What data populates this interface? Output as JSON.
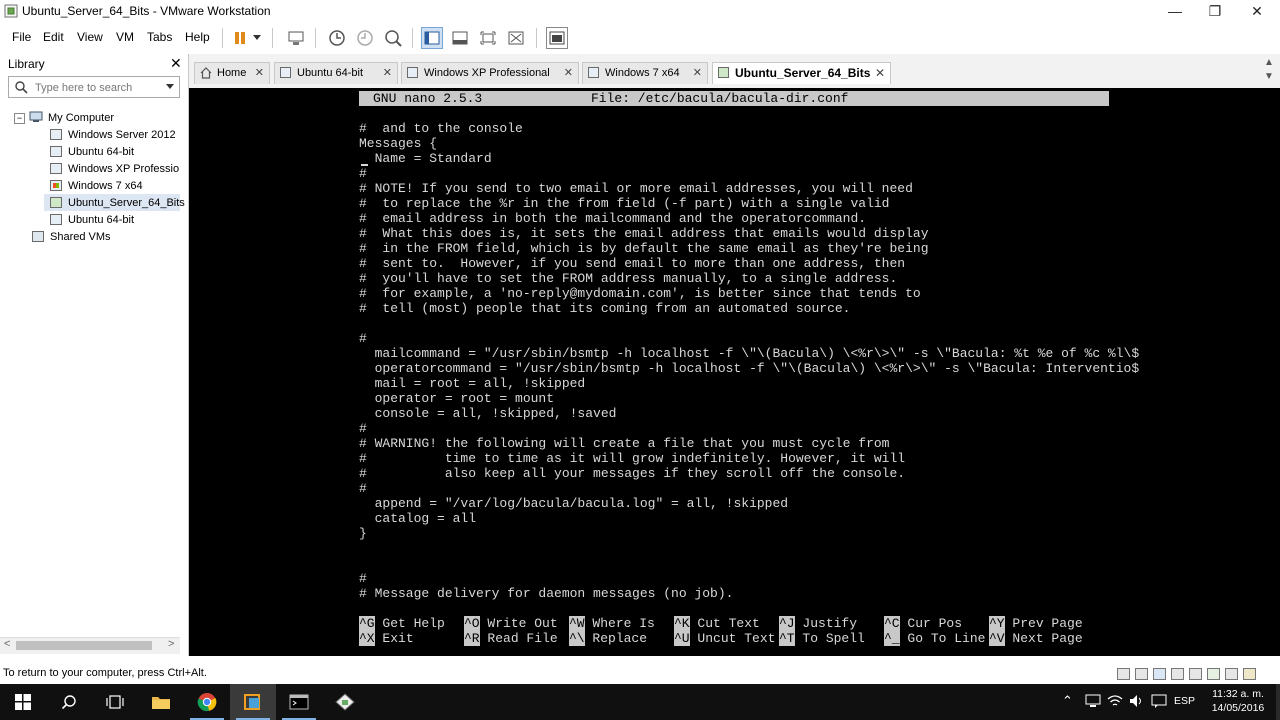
{
  "window": {
    "title": "Ubuntu_Server_64_Bits - VMware Workstation",
    "minimize": "—",
    "maximize": "❐",
    "close": "✕"
  },
  "menu": [
    "File",
    "Edit",
    "View",
    "VM",
    "Tabs",
    "Help"
  ],
  "library": {
    "title": "Library",
    "close": "✕",
    "search_placeholder": "Type here to search",
    "root": "My Computer",
    "items": [
      "Windows Server 2012",
      "Ubuntu 64-bit",
      "Windows XP Professio",
      "Windows 7 x64",
      "Ubuntu_Server_64_Bits",
      "Ubuntu 64-bit"
    ],
    "shared": "Shared VMs",
    "scroll_left": "<",
    "scroll_right": ">"
  },
  "tabs": [
    {
      "label": "Home",
      "icon": "home-icon",
      "active": false
    },
    {
      "label": "Ubuntu 64-bit",
      "icon": "vm-icon",
      "active": false
    },
    {
      "label": "Windows XP Professional",
      "icon": "vm-icon",
      "active": false
    },
    {
      "label": "Windows 7 x64",
      "icon": "vm-icon",
      "active": false
    },
    {
      "label": "Ubuntu_Server_64_Bits",
      "icon": "vm-icon",
      "active": true
    }
  ],
  "tab_close": "✕",
  "nano": {
    "header_left": "GNU nano 2.5.3",
    "header_file": "File: /etc/bacula/bacula-dir.conf",
    "lines": [
      "#  and to the console",
      "Messages {",
      "  Name = Standard",
      "#",
      "# NOTE! If you send to two email or more email addresses, you will need",
      "#  to replace the %r in the from field (-f part) with a single valid",
      "#  email address in both the mailcommand and the operatorcommand.",
      "#  What this does is, it sets the email address that emails would display",
      "#  in the FROM field, which is by default the same email as they're being",
      "#  sent to.  However, if you send email to more than one address, then",
      "#  you'll have to set the FROM address manually, to a single address.",
      "#  for example, a 'no-reply@mydomain.com', is better since that tends to",
      "#  tell (most) people that its coming from an automated source.",
      "",
      "#",
      "  mailcommand = \"/usr/sbin/bsmtp -h localhost -f \\\"\\(Bacula\\) \\<%r\\>\\\" -s \\\"Bacula: %t %e of %c %l\\$",
      "  operatorcommand = \"/usr/sbin/bsmtp -h localhost -f \\\"\\(Bacula\\) \\<%r\\>\\\" -s \\\"Bacula: Interventio$",
      "  mail = root = all, !skipped",
      "  operator = root = mount",
      "  console = all, !skipped, !saved",
      "#",
      "# WARNING! the following will create a file that you must cycle from",
      "#          time to time as it will grow indefinitely. However, it will",
      "#          also keep all your messages if they scroll off the console.",
      "#",
      "  append = \"/var/log/bacula/bacula.log\" = all, !skipped",
      "  catalog = all",
      "}",
      "",
      "",
      "#",
      "# Message delivery for daemon messages (no job)."
    ],
    "shortcuts_row1": [
      {
        "key": "^G",
        "desc": "Get Help"
      },
      {
        "key": "^O",
        "desc": "Write Out"
      },
      {
        "key": "^W",
        "desc": "Where Is"
      },
      {
        "key": "^K",
        "desc": "Cut Text"
      },
      {
        "key": "^J",
        "desc": "Justify"
      },
      {
        "key": "^C",
        "desc": "Cur Pos"
      },
      {
        "key": "^Y",
        "desc": "Prev Page"
      }
    ],
    "shortcuts_row2": [
      {
        "key": "^X",
        "desc": "Exit"
      },
      {
        "key": "^R",
        "desc": "Read File"
      },
      {
        "key": "^\\",
        "desc": "Replace"
      },
      {
        "key": "^U",
        "desc": "Uncut Text"
      },
      {
        "key": "^T",
        "desc": "To Spell"
      },
      {
        "key": "^_",
        "desc": "Go To Line"
      },
      {
        "key": "^V",
        "desc": "Next Page"
      }
    ]
  },
  "status": {
    "text": "To return to your computer, press Ctrl+Alt."
  },
  "taskbar": {
    "language": "ESP",
    "time": "11:32 a. m.",
    "date": "14/05/2016"
  },
  "colors": {
    "terminal_bg": "#000000",
    "terminal_fg": "#d8d8d8",
    "nano_bar": "#c8c8c8",
    "taskbar": "#101010",
    "accent": "#7fb2e5"
  }
}
